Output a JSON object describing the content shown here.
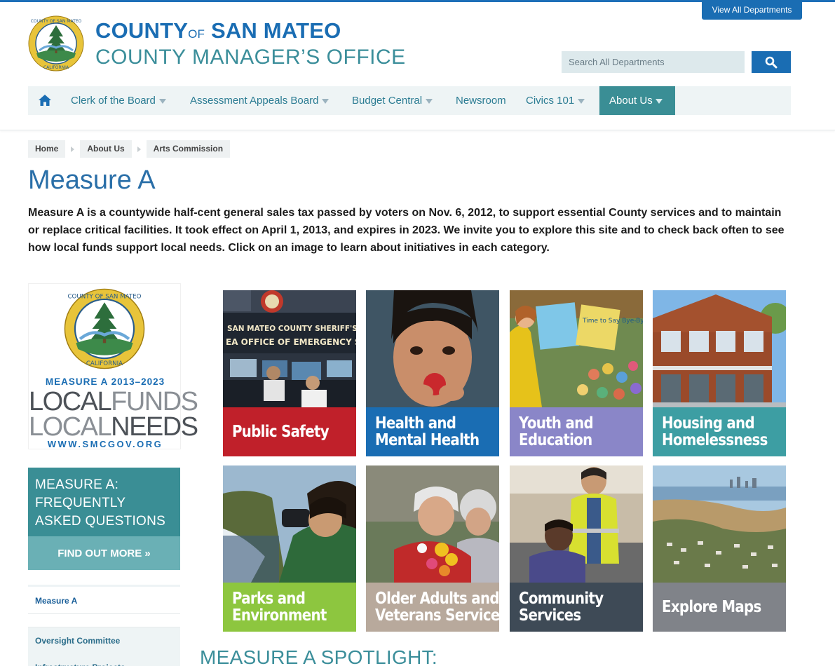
{
  "header": {
    "view_all_label": "View All Departments",
    "title_county": "COUNTY",
    "title_of": "OF",
    "title_san_mateo": "SAN MATEO",
    "title_office": "COUNTY MANAGER’S OFFICE",
    "search_placeholder": "Search All Departments",
    "seal_top_text": "COUNTY OF SAN MATEO",
    "seal_bottom_text": "CALIFORNIA"
  },
  "nav": {
    "items": [
      {
        "label": "Clerk of the Board"
      },
      {
        "label": "Assessment Appeals Board"
      },
      {
        "label": "Budget Central"
      },
      {
        "label": "Newsroom"
      },
      {
        "label": "Civics 101"
      },
      {
        "label": "About Us"
      }
    ]
  },
  "breadcrumb": [
    "Home",
    "About Us",
    "Arts Commission"
  ],
  "page": {
    "title": "Measure A",
    "intro": "Measure A is a countywide half-cent general sales tax passed by voters on Nov. 6, 2012, to support essential County services and to maintain or replace critical facilities. It took effect on April 1, 2013, and expires in 2023. We invite you to explore this site and to check back often to see how local funds support local needs. Click on an image to learn about initiatives in each category.",
    "spotlight": "MEASURE A SPOTLIGHT:"
  },
  "promo": {
    "years": "MEASURE A 2013–2023",
    "line1_a": "LOCAL",
    "line1_b": "FUNDS",
    "line2_a": "LOCAL",
    "line2_b": "NEEDS",
    "url": "WWW.SMCGOV.ORG"
  },
  "faq": {
    "title": "MEASURE A: FREQUENTLY ASKED QUESTIONS",
    "button": "FIND OUT MORE »"
  },
  "side_nav": {
    "items": [
      "Measure A",
      "Oversight Committee",
      "Infrastructure Projects"
    ]
  },
  "photo_sign": {
    "line1": "SAN MATEO COUNTY SHERIFF'S",
    "line2": "EA OFFICE OF EMERGENCY SERVICE"
  },
  "book_text": "Time to Say Bye-Bye",
  "tiles": [
    {
      "line1": "Public Safety",
      "line2": "",
      "color": "#c0202a"
    },
    {
      "line1": "Health and",
      "line2": "Mental Health",
      "color": "#1a6db3"
    },
    {
      "line1": "Youth and",
      "line2": "Education",
      "color": "#8a86c8"
    },
    {
      "line1": "Housing and",
      "line2": "Homelessness",
      "color": "#3d9ea3"
    },
    {
      "line1": "Parks and",
      "line2": "Environment",
      "color": "#8dc63f"
    },
    {
      "line1": "Older Adults and",
      "line2": "Veterans Services",
      "color": "#b8a99c"
    },
    {
      "line1": "Community",
      "line2": "Services",
      "color": "#3e4a56"
    },
    {
      "line1": "Explore Maps",
      "line2": "",
      "color": "#808389"
    }
  ]
}
